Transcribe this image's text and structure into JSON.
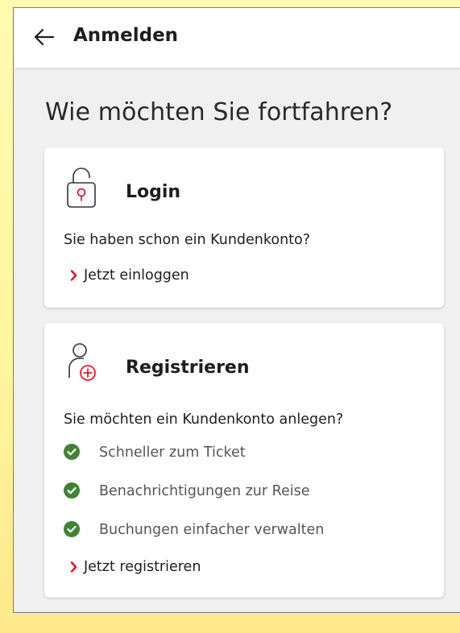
{
  "appbar": {
    "title": "Anmelden"
  },
  "page": {
    "heading": "Wie möchten Sie fortfahren?"
  },
  "login": {
    "title": "Login",
    "text": "Sie haben schon ein Kundenkonto?",
    "link": "Jetzt einloggen"
  },
  "register": {
    "title": "Registrieren",
    "text": "Sie möchten ein Kundenkonto anlegen?",
    "benefits": [
      "Schneller zum Ticket",
      "Benachrichtigungen zur Reise",
      "Buchungen einfacher verwalten"
    ],
    "link": "Jetzt registrieren"
  },
  "colors": {
    "accent": "#ec0016",
    "check": "#408335",
    "text": "#1e1e1e",
    "muted": "#555555"
  },
  "icons": {
    "back": "arrow-left-icon",
    "login": "lock-open-icon",
    "register": "user-add-icon",
    "benefit": "check-circle-icon",
    "link": "chevron-right-icon"
  }
}
